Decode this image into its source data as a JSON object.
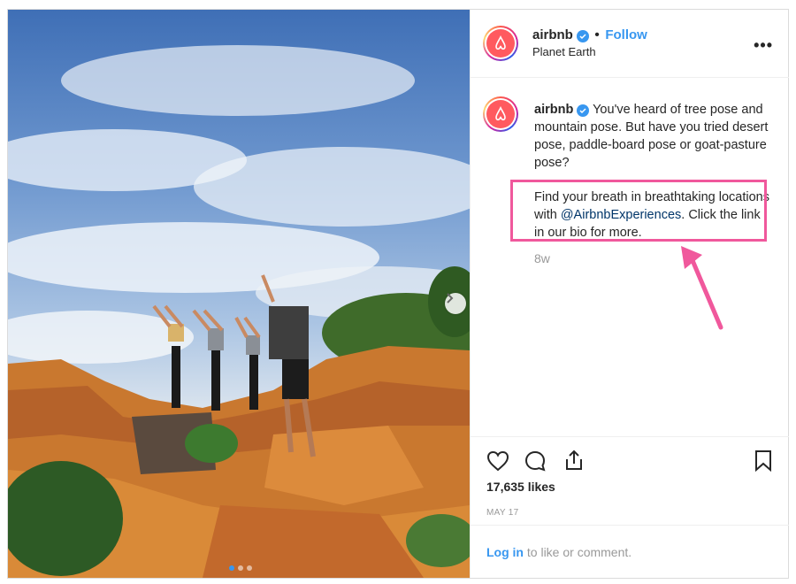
{
  "post": {
    "username": "airbnb",
    "follow_label": "Follow",
    "separator": "•",
    "location": "Planet Earth",
    "more_label": "•••",
    "caption_line1": "You've heard of tree pose and mountain pose. But have you tried desert pose, paddle-board pose or goat-pasture pose?",
    "caption_line2_a": "Find your breath in breathtaking locations with ",
    "caption_mention": "@AirbnbExperiences",
    "caption_line2_b": ". Click the link in our bio for more.",
    "time_ago": "8w",
    "likes": "17,635 likes",
    "date": "MAY 17",
    "login_link": "Log in",
    "login_rest": " to like or comment."
  },
  "carousel": {
    "total": 3,
    "active": 1
  },
  "colors": {
    "accent": "#3897f0",
    "highlight": "#f0589c",
    "brand": "#ff5a5f"
  },
  "icons": [
    "heart-icon",
    "comment-icon",
    "share-icon",
    "bookmark-icon",
    "verified-icon",
    "chevron-right-icon"
  ]
}
